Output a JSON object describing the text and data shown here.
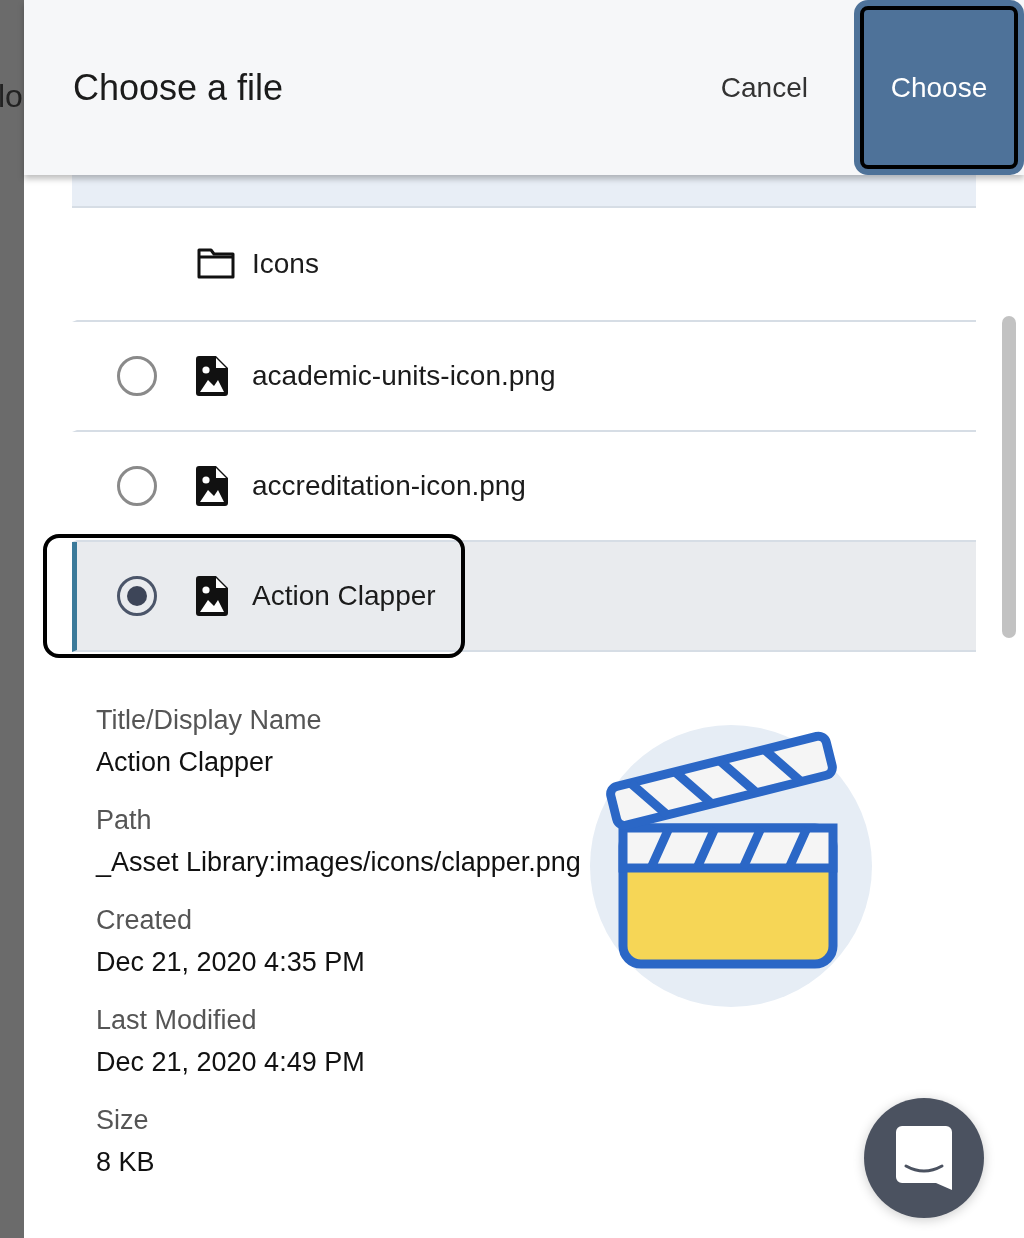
{
  "background": {
    "text": "lo"
  },
  "dialog": {
    "title": "Choose a file",
    "buttons": [
      {
        "label": "Cancel",
        "kind": "secondary",
        "focused": false
      },
      {
        "label": "Choose",
        "kind": "primary",
        "focused": true
      }
    ]
  },
  "items": [
    {
      "kind": "folder",
      "name": "Icons"
    },
    {
      "kind": "file",
      "name": "academic-units-icon.png",
      "selected": false,
      "focused": false
    },
    {
      "kind": "file",
      "name": "accreditation-icon.png",
      "selected": false,
      "focused": false
    },
    {
      "kind": "file",
      "name": "Action Clapper",
      "selected": true,
      "focused": true
    }
  ],
  "details": [
    {
      "label": "Title/Display Name",
      "value": "Action Clapper"
    },
    {
      "label": "Path",
      "value": "_Asset Library:images/icons/clapper.png"
    },
    {
      "label": "Created",
      "value": "Dec 21, 2020 4:35 PM"
    },
    {
      "label": "Last Modified",
      "value": "Dec 21, 2020 4:49 PM"
    },
    {
      "label": "Size",
      "value": "8 KB"
    }
  ]
}
